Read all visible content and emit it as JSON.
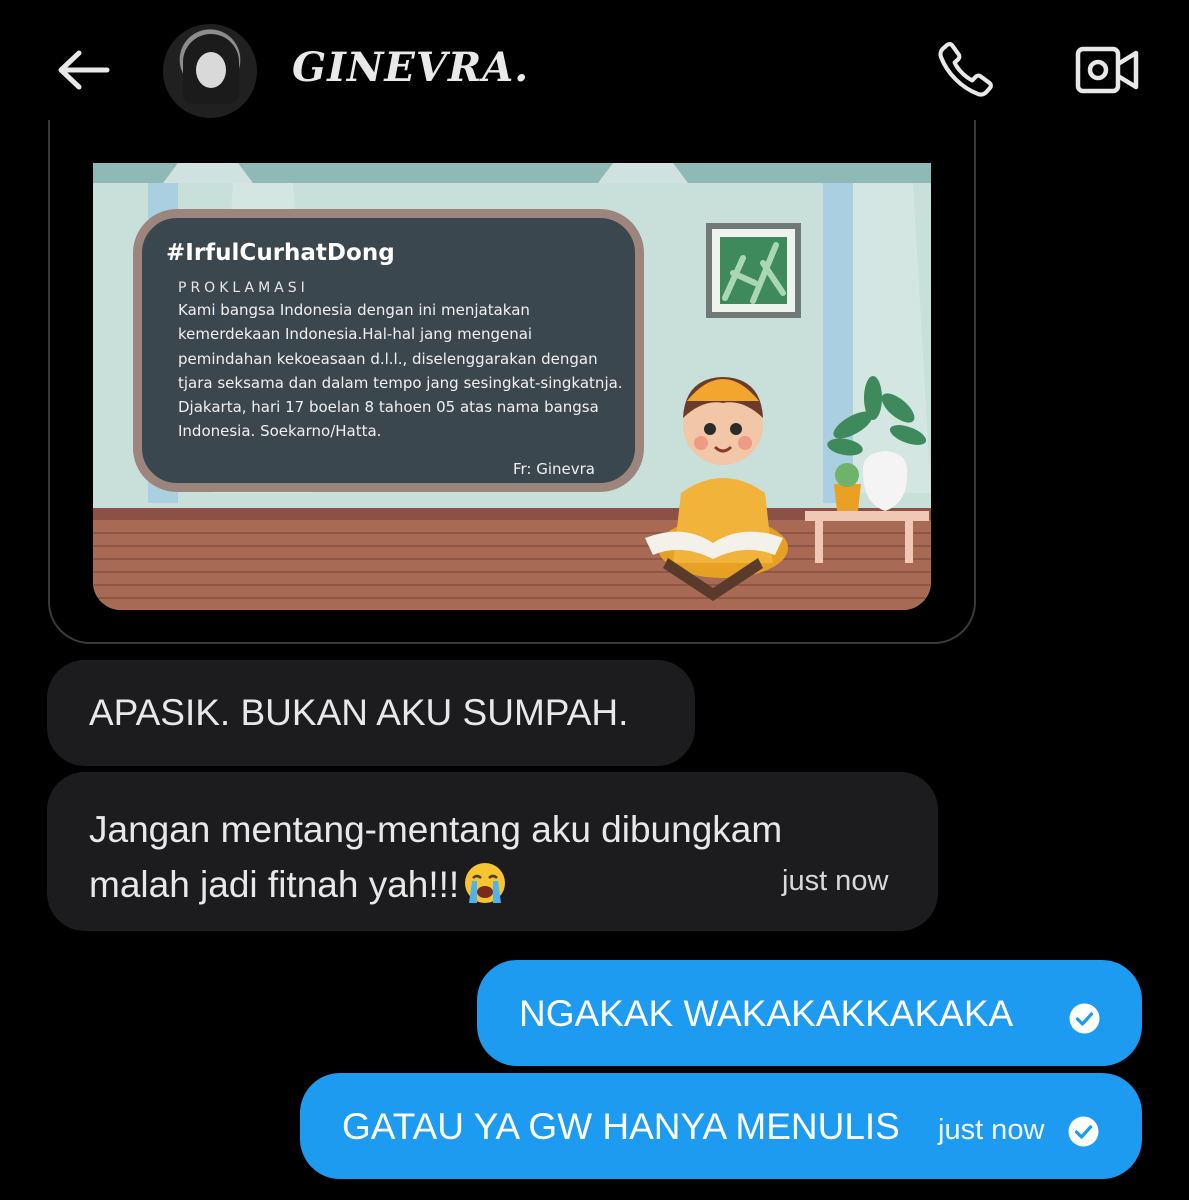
{
  "header": {
    "contact_name": "GINEVRA.",
    "back_icon": "arrow-left-icon",
    "call_icon": "phone-icon",
    "video_icon": "video-camera-icon"
  },
  "image_message": {
    "board_title": "#IrfulCurhatDong",
    "board_heading": "PROKLAMASI",
    "board_body": "Kami bangsa Indonesia dengan ini menjatakan kemerdekaan Indonesia.Hal-hal jang mengenai pemindahan kekoeasaan d.l.l., diselenggarakan dengan tjara seksama dan dalam tempo jang sesingkat-singkatnja. Djakarta, hari 17 boelan 8 tahoen 05 atas nama bangsa Indonesia. Soekarno/Hatta.",
    "board_credit": "Fr: Ginevra"
  },
  "messages": [
    {
      "direction": "incoming",
      "text": "APASIK. BUKAN AKU SUMPAH."
    },
    {
      "direction": "incoming",
      "text": "Jangan mentang-mentang aku dibungkam malah jadi fitnah yah!!!",
      "emoji": "loudly-crying-face",
      "time": "just now"
    },
    {
      "direction": "outgoing",
      "text": "NGAKAK WAKAKAKKAKAKA",
      "status_icon": "check-circle-icon"
    },
    {
      "direction": "outgoing",
      "text": "GATAU YA GW HANYA MENULIS",
      "time": "just now",
      "status_icon": "check-circle-icon"
    }
  ],
  "colors": {
    "background": "#000000",
    "incoming_bubble": "#1c1c1e",
    "outgoing_bubble": "#1d9bf0",
    "chalkboard": "#3b474f",
    "board_frame": "#9b857d"
  }
}
